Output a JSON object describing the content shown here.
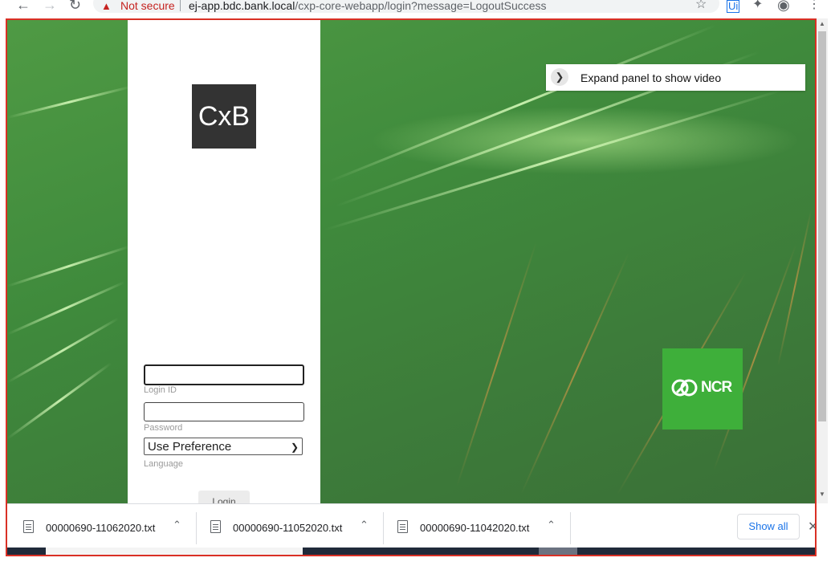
{
  "browser": {
    "security_label": "Not secure",
    "url_host": "ej-app.bdc.bank.local",
    "url_path": "/cxp-core-webapp/login?message=LogoutSuccess",
    "icons": [
      "back-icon",
      "forward-icon",
      "reload-icon",
      "warning-icon",
      "star-icon",
      "extension-icon",
      "puzzle-icon",
      "profile-icon",
      "menu-icon"
    ]
  },
  "login": {
    "logo_text": "CxB",
    "login_id_label": "Login ID",
    "login_id_value": "",
    "password_label": "Password",
    "password_value": "",
    "language_value": "Use Preference",
    "language_label": "Language",
    "login_button": "Login"
  },
  "video_panel": {
    "label": "Expand panel to show video"
  },
  "brand": {
    "ncr_text": "NCR",
    "ncr_color": "#3eaf3a",
    "bg_green": "#3f8a3c"
  },
  "downloads": {
    "items": [
      {
        "filename": "00000690-11062020.txt"
      },
      {
        "filename": "00000690-11052020.txt"
      },
      {
        "filename": "00000690-11042020.txt"
      }
    ],
    "show_all_label": "Show all"
  }
}
